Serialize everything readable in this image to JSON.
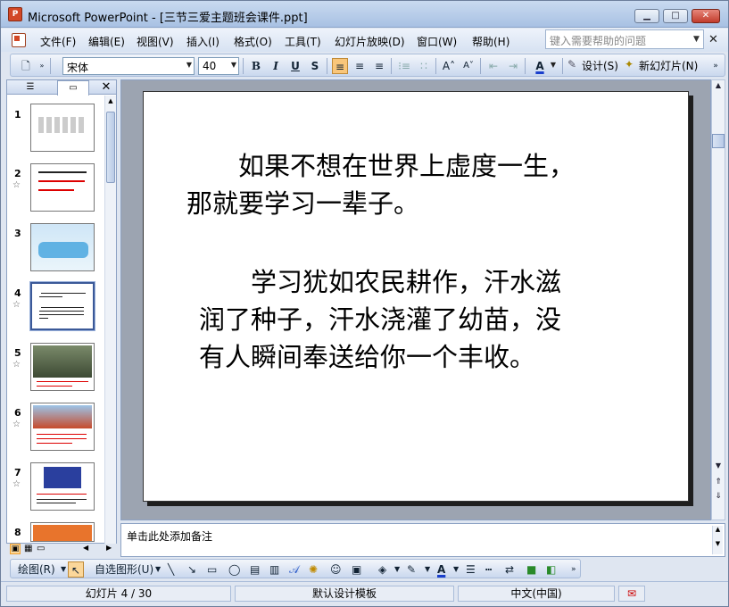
{
  "window": {
    "title": "Microsoft PowerPoint - [三节三爱主题班会课件.ppt]",
    "app_icon": "P",
    "caption_buttons": {
      "minimize": "▁",
      "maximize": "□",
      "close": "✕"
    }
  },
  "menu": {
    "items": [
      "文件(F)",
      "编辑(E)",
      "视图(V)",
      "插入(I)",
      "格式(O)",
      "工具(T)",
      "幻灯片放映(D)",
      "窗口(W)",
      "帮助(H)"
    ],
    "help_placeholder": "键入需要帮助的问题",
    "help_close": "✕"
  },
  "toolbar": {
    "font": "宋体",
    "size": "40",
    "bold": "B",
    "italic": "I",
    "underline": "U",
    "shadow": "S",
    "design": "设计(S)",
    "new_slide": "新幻灯片(N)",
    "font_color": "A"
  },
  "pane": {
    "tab_outline_icon": "outline-icon",
    "tab_slides_icon": "slides-icon",
    "close": "✕",
    "slides": [
      {
        "num": "1",
        "star": ""
      },
      {
        "num": "2",
        "star": "☆"
      },
      {
        "num": "3",
        "star": ""
      },
      {
        "num": "4",
        "star": "☆"
      },
      {
        "num": "5",
        "star": "☆"
      },
      {
        "num": "6",
        "star": "☆"
      },
      {
        "num": "7",
        "star": "☆"
      },
      {
        "num": "8",
        "star": ""
      }
    ]
  },
  "slide": {
    "p1": "　　如果不想在世界上虚度一生，那就要学习一辈子。",
    "p2": "　　学习犹如农民耕作，汗水滋润了种子，汗水浇灌了幼苗，没有人瞬间奉送给你一个丰收。"
  },
  "notes": {
    "placeholder": "单击此处添加备注"
  },
  "drawbar": {
    "draw": "绘图(R)",
    "autoshapes": "自选图形(U)"
  },
  "status": {
    "slide": "幻灯片 4 / 30",
    "template": "默认设计模板",
    "language": "中文(中国)"
  }
}
